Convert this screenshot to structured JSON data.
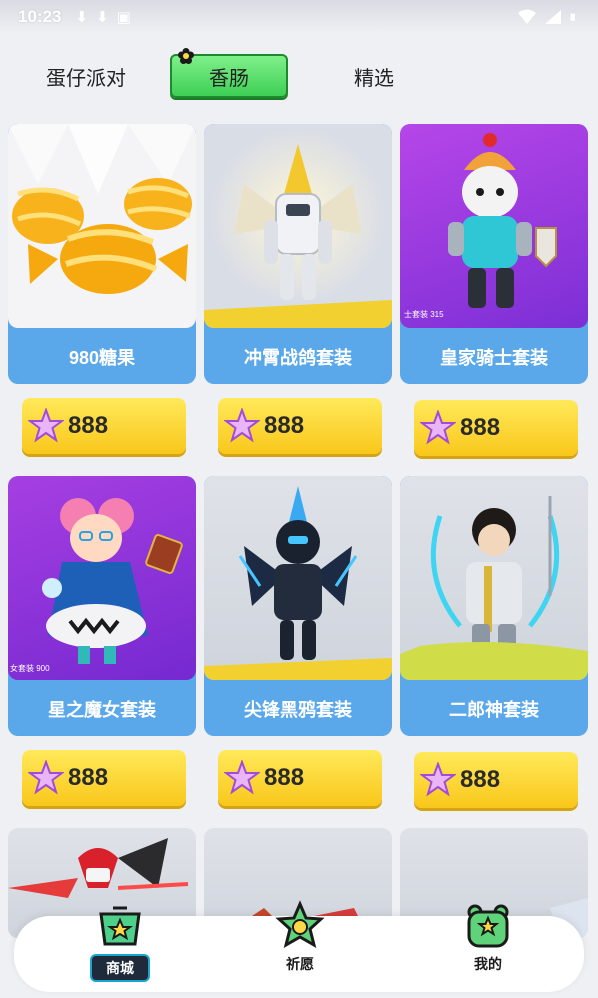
{
  "status_bar": {
    "time": "10:23"
  },
  "tabs": [
    {
      "label": "蛋仔派对"
    },
    {
      "label": "香肠"
    },
    {
      "label": "精选"
    }
  ],
  "products": [
    {
      "name": "980糖果",
      "price": "888",
      "art_caption": ""
    },
    {
      "name": "冲霄战鸽套装",
      "price": "888",
      "art_caption": ""
    },
    {
      "name": "皇家骑士套装",
      "price": "888",
      "art_caption": "士套装 315"
    },
    {
      "name": "星之魔女套装",
      "price": "888",
      "art_caption": "女套装 900"
    },
    {
      "name": "尖锋黑鸦套装",
      "price": "888",
      "art_caption": ""
    },
    {
      "name": "二郎神套装",
      "price": "888",
      "art_caption": ""
    }
  ],
  "bottom_nav": [
    {
      "label": "商城",
      "icon": "shop-icon"
    },
    {
      "label": "祈愿",
      "icon": "wish-icon"
    },
    {
      "label": "我的",
      "icon": "profile-icon"
    }
  ],
  "colors": {
    "accent_green": "#3ecf55",
    "card_blue": "#5aa7ea",
    "price_yellow": "#f9c71b"
  }
}
